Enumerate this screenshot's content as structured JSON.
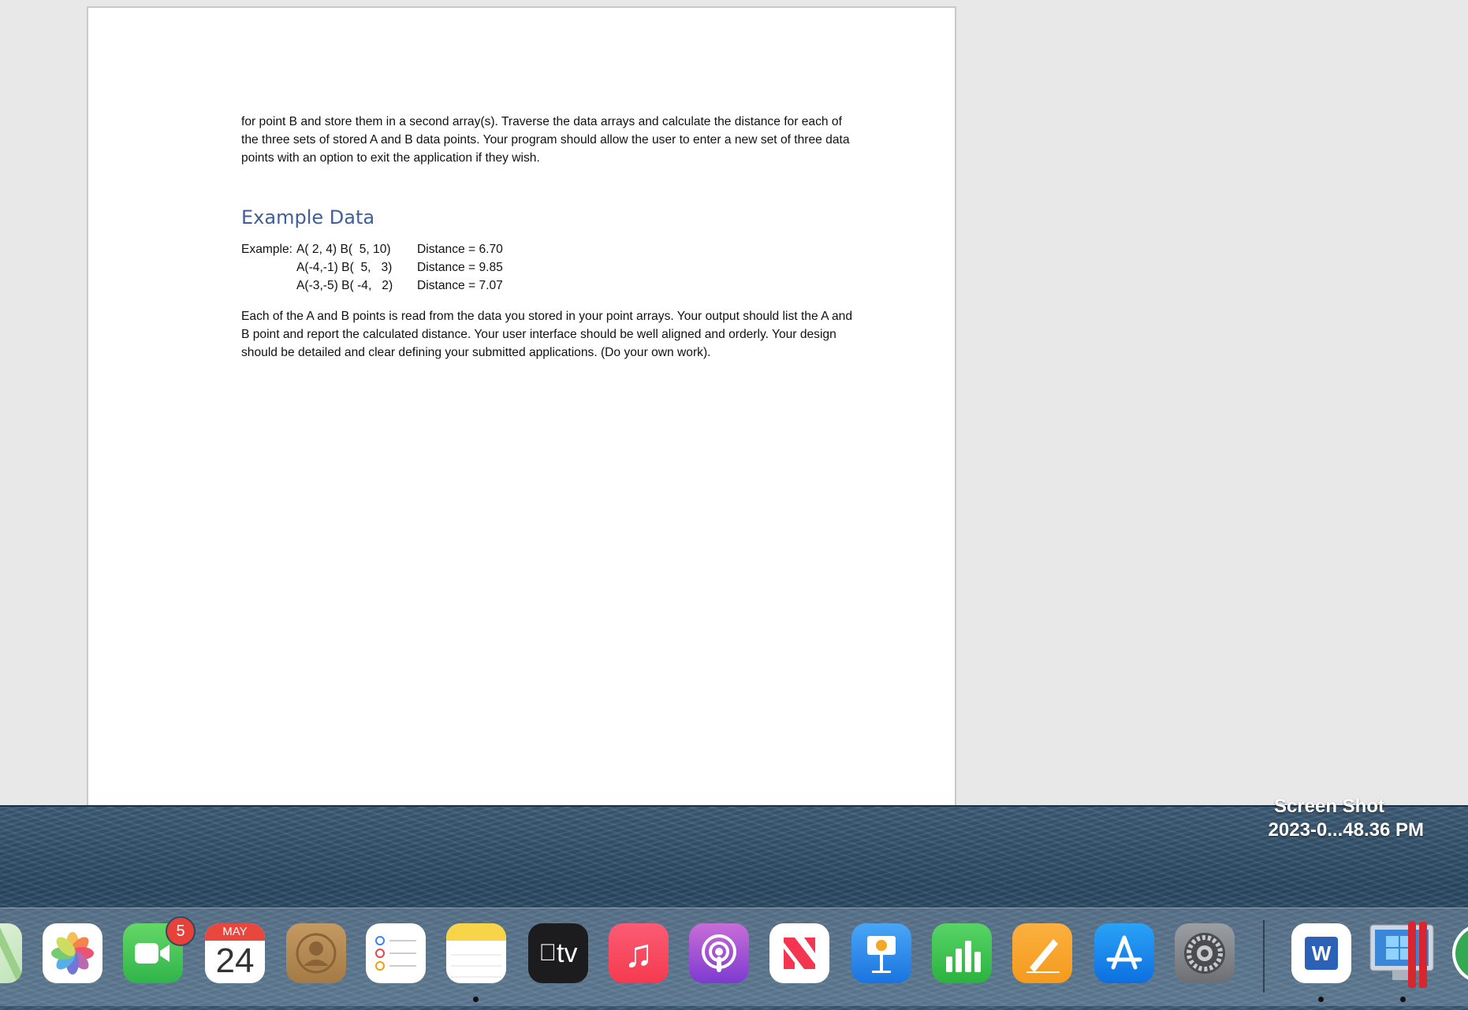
{
  "document": {
    "paragraph_1": "for point B and store them in a second array(s).  Traverse the data arrays and calculate the distance for each of the three sets of stored A and B data points.  Your program should allow the user to enter a new set of three data points with an option to exit the application if they wish.",
    "heading": "Example Data",
    "example_label": "Example:",
    "examples": [
      {
        "points": "A( 2, 4) B(  5, 10)",
        "distance": "Distance = 6.70"
      },
      {
        "points": "A(-4,-1) B(  5,   3)",
        "distance": "Distance = 9.85"
      },
      {
        "points": "A(-3,-5) B( -4,   2)",
        "distance": "Distance = 7.07"
      }
    ],
    "paragraph_2": "Each of the A and B points is read from the data you stored in your point arrays.  Your output should list the A and B point and report the calculated distance.   Your user interface should be well aligned and orderly.  Your design should be detailed and clear defining your submitted applications. (Do your own work)."
  },
  "desktop": {
    "file_label_top": "Screen Shot",
    "file_label": "2023-0...48.36 PM"
  },
  "dock": {
    "facetime_badge": "5",
    "calendar_month": "MAY",
    "calendar_day": "24",
    "tv_label": "tv",
    "word_letter": "W"
  }
}
